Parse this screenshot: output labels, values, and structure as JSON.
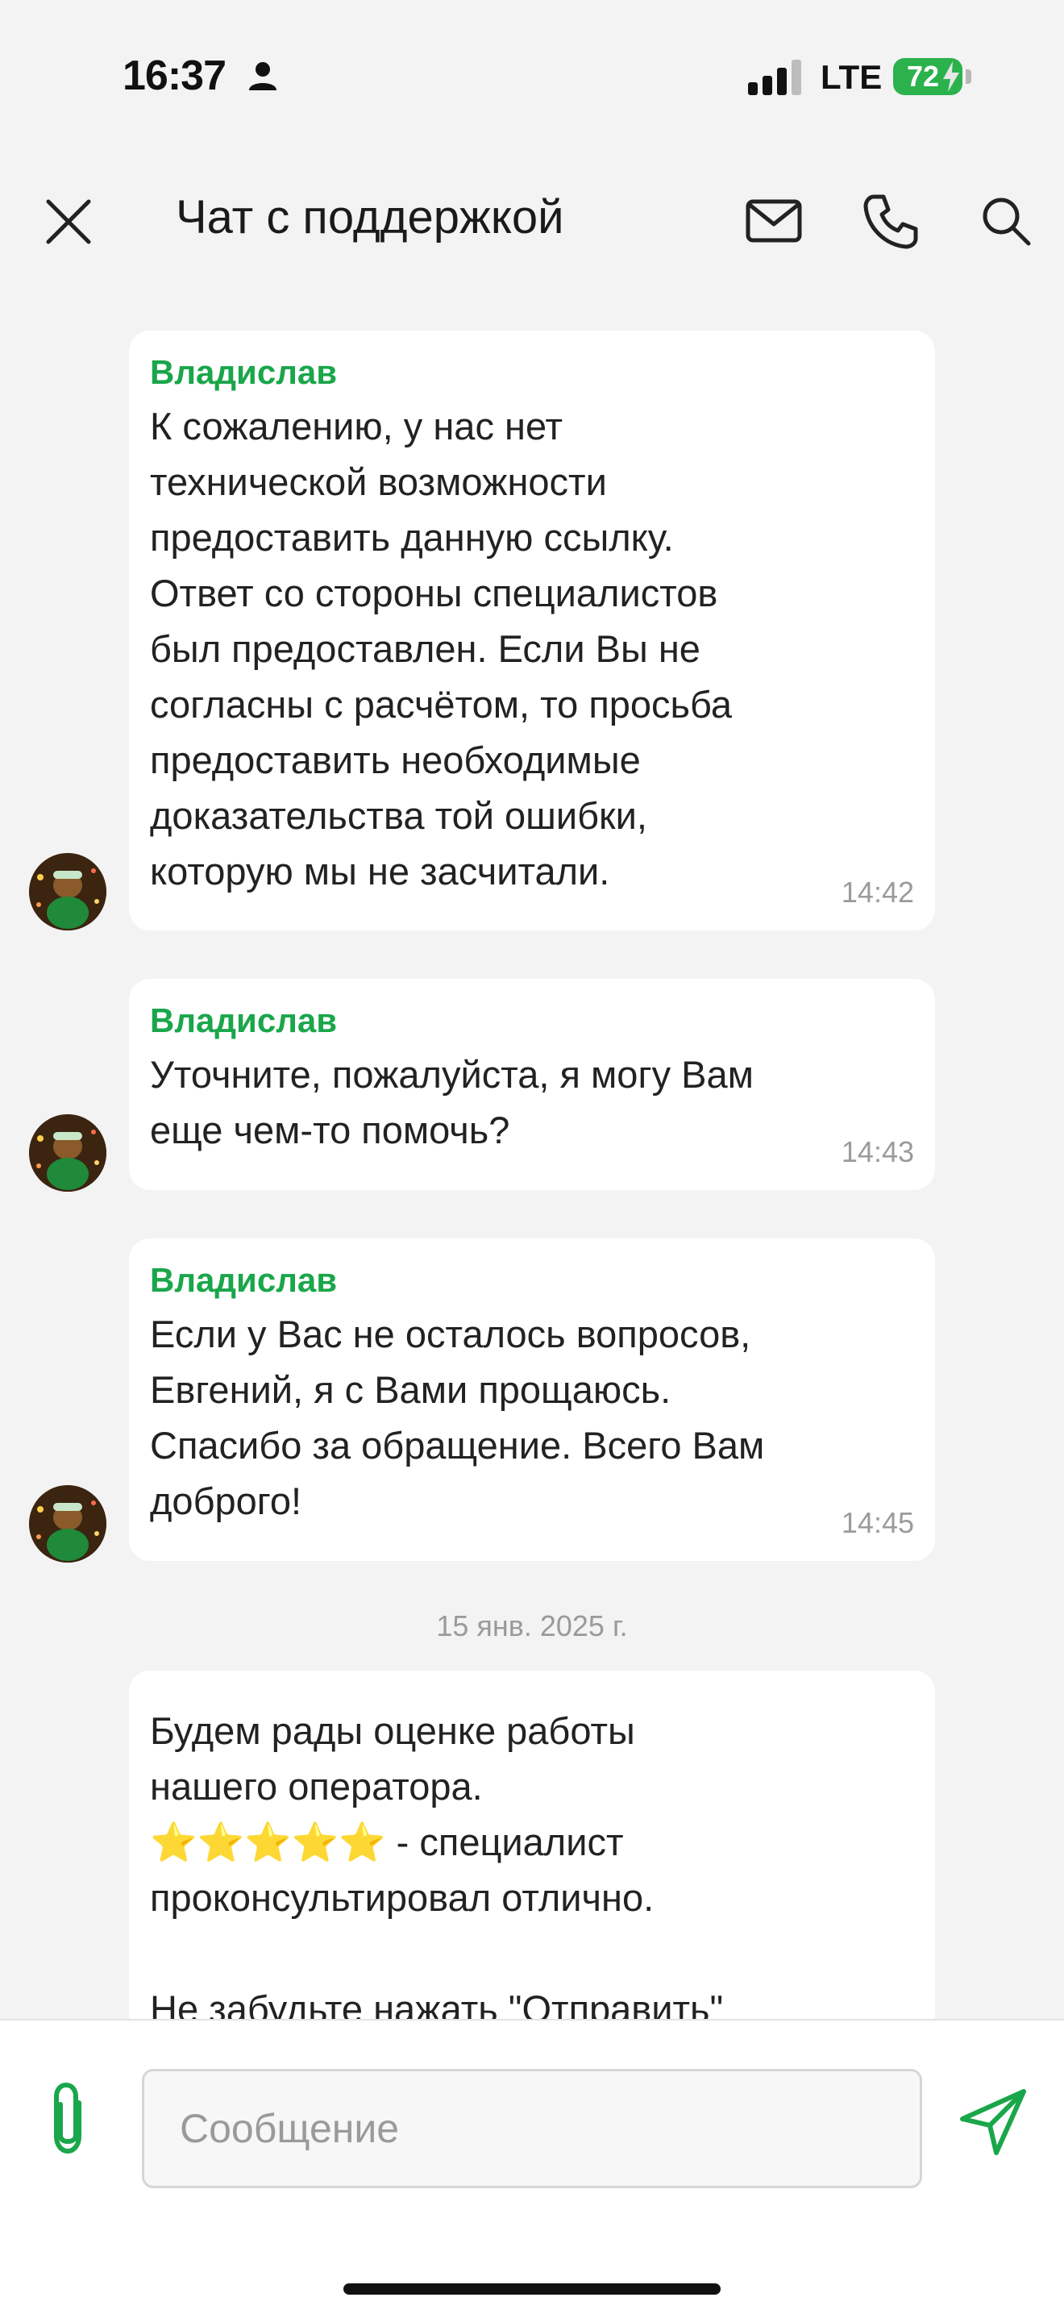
{
  "status_bar": {
    "time": "16:37",
    "network": "LTE",
    "battery": "72",
    "icons": [
      "person-icon",
      "signal-icon",
      "battery-icon",
      "charging-bolt-icon"
    ]
  },
  "header": {
    "title": "Чат с поддержкой",
    "icons": [
      "close-icon",
      "mail-icon",
      "phone-icon",
      "search-icon"
    ]
  },
  "messages": [
    {
      "sender": "Владислав",
      "text": "К сожалению, у нас нет\nтехнической возможности\nпредоставить данную ссылку.\nОтвет со стороны специалистов\nбыл предоставлен. Если Вы не\nсогласны с расчётом, то просьба\nпредоставить необходимые\nдоказательства той ошибки,\nкоторую мы не засчитали.",
      "time": "14:42"
    },
    {
      "sender": "Владислав",
      "text": "Уточните, пожалуйста, я могу Вам\nеще чем-то помочь?",
      "time": "14:43"
    },
    {
      "sender": "Владислав",
      "text": "Если у Вас не осталось вопросов,\nЕвгений, я с Вами прощаюсь.\nСпасибо за обращение. Всего Вам\nдоброго!",
      "time": "14:45"
    }
  ],
  "date_separator": "15 янв. 2025 г.",
  "rating_message": {
    "text": "Будем рады оценке работы\nнашего оператора.\n⭐⭐⭐⭐⭐ - специалист\nпроконсультировал отлично.\n\nНе забудьте нажать \"Отправить\""
  },
  "input": {
    "placeholder": "Сообщение",
    "value": ""
  },
  "colors": {
    "accent": "#1aa64a",
    "background": "#f3f3f3",
    "bubble": "#ffffff",
    "battery": "#2bb24c"
  }
}
